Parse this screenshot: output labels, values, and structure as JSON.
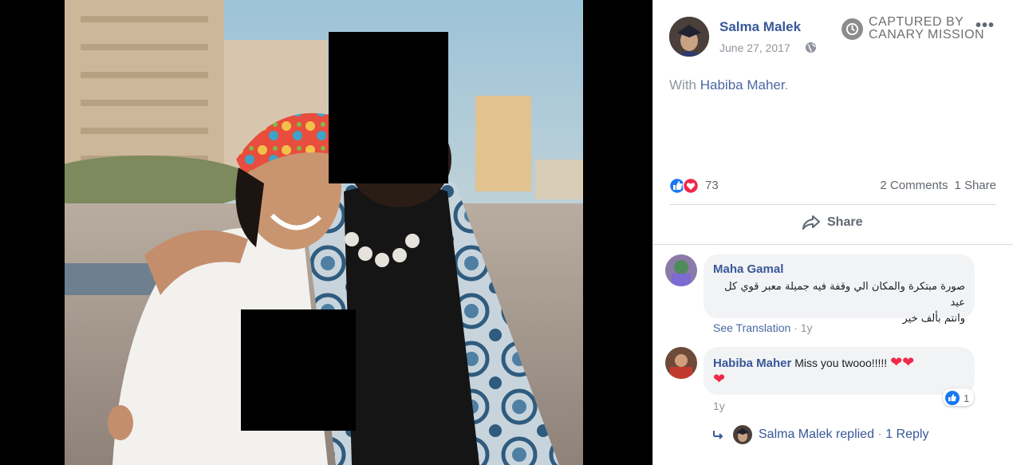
{
  "post": {
    "author": "Salma Malek",
    "date": "June 27, 2017",
    "text_prefix": "With ",
    "tagged": "Habiba Maher",
    "text_suffix": ".",
    "reaction_count": "73",
    "comments_count": "2 Comments",
    "shares_count": "1 Share",
    "share_label": "Share",
    "more_label": "•••"
  },
  "watermark": {
    "line1": "CAPTURED BY",
    "line2": "CANARY MISSION"
  },
  "comments": [
    {
      "author": "Maha Gamal",
      "text_line1": "صورة مبتكرة والمكان الي وقفة فيه جميلة معبر قوي كل عيد",
      "text_line2": "وانتم بألف خير",
      "action": "See Translation",
      "time": "1y"
    },
    {
      "author": "Habiba Maher",
      "text": "Miss you twooo!!!!! ",
      "hearts_line1": "❤❤",
      "hearts_line2": "❤",
      "time": "1y",
      "like_count": "1"
    }
  ],
  "reply": {
    "author": "Salma Malek",
    "replied_label": "replied",
    "separator": "·",
    "reply_count": "1 Reply"
  },
  "icons": [
    "globe-icon",
    "share-arrow-icon",
    "like-icon",
    "love-icon",
    "reply-arrow-icon",
    "clock-icon"
  ],
  "colors": {
    "link": "#385898",
    "muted": "#90949c",
    "like_blue": "#1877f2",
    "love_red": "#f02849"
  }
}
